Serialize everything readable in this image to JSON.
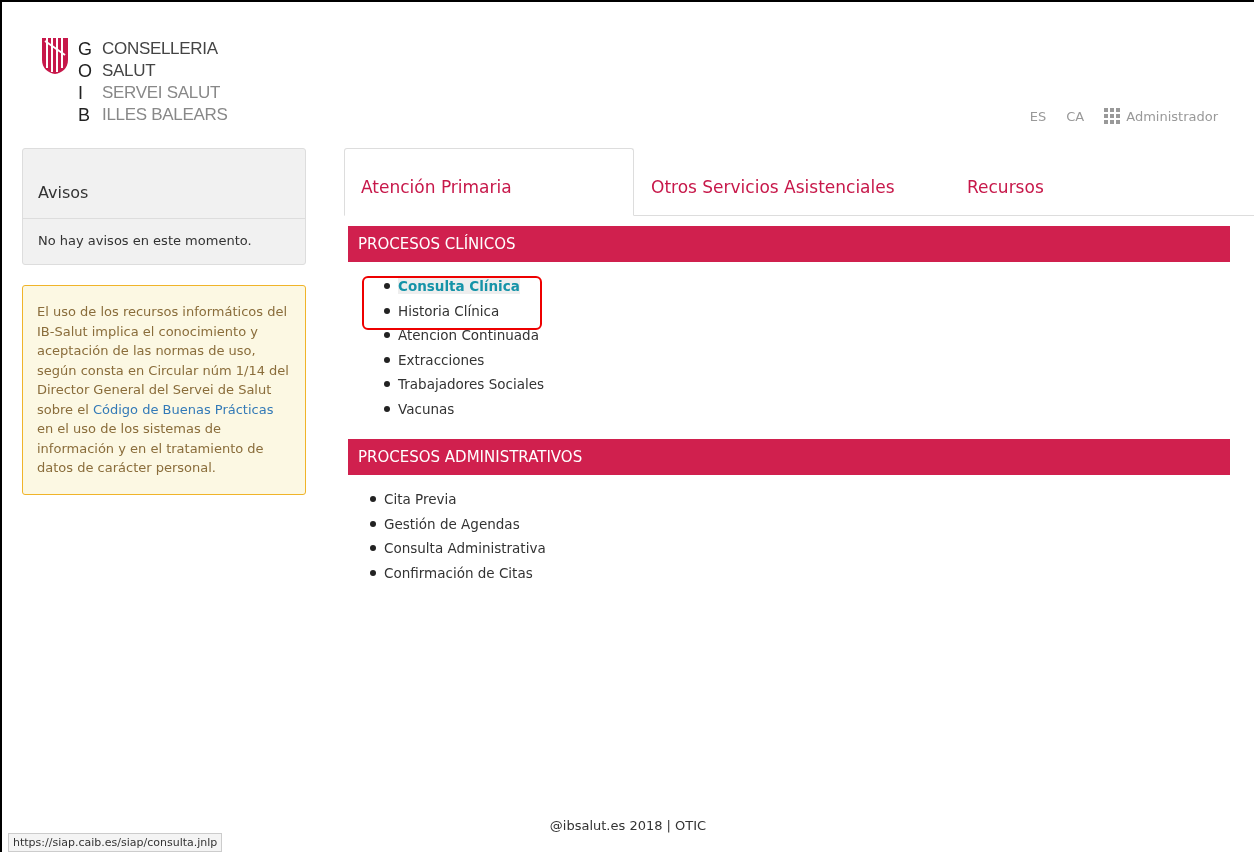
{
  "logo": {
    "letters": [
      "G",
      "O",
      "I",
      "B"
    ],
    "lines": [
      "CONSELLERIA",
      "SALUT",
      "SERVEI SALUT",
      "ILLES BALEARS"
    ]
  },
  "header": {
    "languages": [
      "ES",
      "CA"
    ],
    "user": "Administrador"
  },
  "notices": {
    "title": "Avisos",
    "message": "No hay avisos en este momento."
  },
  "policy": {
    "before": "El uso de los recursos informáticos del IB-Salut implica el conocimiento y aceptación de las normas de uso, según consta en Circular núm 1/14 del Director General del Servei de Salut sobre el",
    "link": "Código de Buenas Prácticas",
    "after": "en el uso de los sistemas de información y en el tratamiento de datos de carácter personal."
  },
  "tabs": [
    {
      "label": "Atención Primaria",
      "selected": true
    },
    {
      "label": "Otros Servicios Asistenciales",
      "selected": false
    },
    {
      "label": "Recursos",
      "selected": false
    }
  ],
  "sections": [
    {
      "title": "PROCESOS CLÍNICOS",
      "items": [
        {
          "label": "Consulta Clínica",
          "selected": true
        },
        {
          "label": "Historia Clínica",
          "selected": false
        },
        {
          "label": "Atencion Continuada",
          "selected": false
        },
        {
          "label": "Extracciones",
          "selected": false
        },
        {
          "label": "Trabajadores Sociales",
          "selected": false
        },
        {
          "label": "Vacunas",
          "selected": false
        }
      ]
    },
    {
      "title": "PROCESOS ADMINISTRATIVOS",
      "items": [
        {
          "label": "Cita Previa",
          "selected": false
        },
        {
          "label": "Gestión de Agendas",
          "selected": false
        },
        {
          "label": "Consulta Administrativa",
          "selected": false
        },
        {
          "label": "Confirmación de Citas",
          "selected": false
        }
      ]
    }
  ],
  "footer": "@ibsalut.es 2018 | OTIC",
  "status_url": "https://siap.caib.es/siap/consulta.jnlp"
}
